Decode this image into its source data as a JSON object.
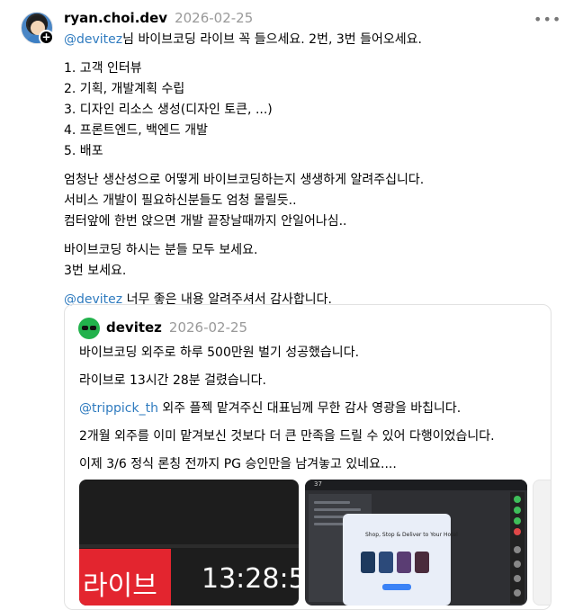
{
  "post": {
    "username": "ryan.choi.dev",
    "date": "2026-02-25",
    "more_label": "•••",
    "follow_badge": "+",
    "lines": [
      {
        "mention": "@devitez",
        "text": "님 바이브코딩 라이브 꼭 들으세요. 2번, 3번 들어오세요."
      },
      {
        "gap": true
      },
      {
        "text": "1. 고객 인터뷰"
      },
      {
        "text": "2. 기획, 개발계획 수립"
      },
      {
        "text": "3. 디자인 리소스 생성(디자인 토큰, ...)"
      },
      {
        "text": "4. 프론트엔드, 백엔드 개발"
      },
      {
        "text": "5. 배포"
      },
      {
        "gap": true
      },
      {
        "text": "엄청난 생산성으로 어떻게 바이브코딩하는지 생생하게 알려주십니다."
      },
      {
        "text": "서비스 개발이 필요하신분들도 엄청 몰릴듯.."
      },
      {
        "text": "컴터앞에 한번 앉으면 개발 끝장날때까지 안일어나심.."
      },
      {
        "gap": true
      },
      {
        "text": "바이브코딩 하시는 분들 모두 보세요."
      },
      {
        "text": "3번 보세요."
      },
      {
        "gap": true
      },
      {
        "mention": "@devitez",
        "text": " 너무 좋은 내용 알려주셔서 감사합니다."
      }
    ]
  },
  "quote": {
    "username": "devitez",
    "date": "2026-02-25",
    "paragraphs": [
      {
        "text": "바이브코딩 외주로 하루 500만원 벌기 성공했습니다."
      },
      {
        "text": "라이브로 13시간 28분 걸렸습니다."
      },
      {
        "mention": "@trippick_th",
        "text": " 외주 플젝 맡겨주신 대표님께 무한 감사 영광을 바칩니다."
      },
      {
        "text": "2개월 외주를 이미 맡겨보신 것보다 더 큰 만족을 드릴 수 있어 다행이었습니다."
      },
      {
        "text": "이제 3/6 정식 론칭 전까지 PG 승인만을 남겨놓고 있네요...."
      }
    ],
    "media": [
      {
        "red_label": "라이브",
        "timer": "13:28:5"
      },
      {
        "top_label": "37",
        "card_title": "Shop, Stop & Deliver to Your Hotel"
      },
      {}
    ]
  },
  "colors": {
    "mention": "#2f7bbf",
    "date": "#999999",
    "live_red": "#e3252f"
  }
}
